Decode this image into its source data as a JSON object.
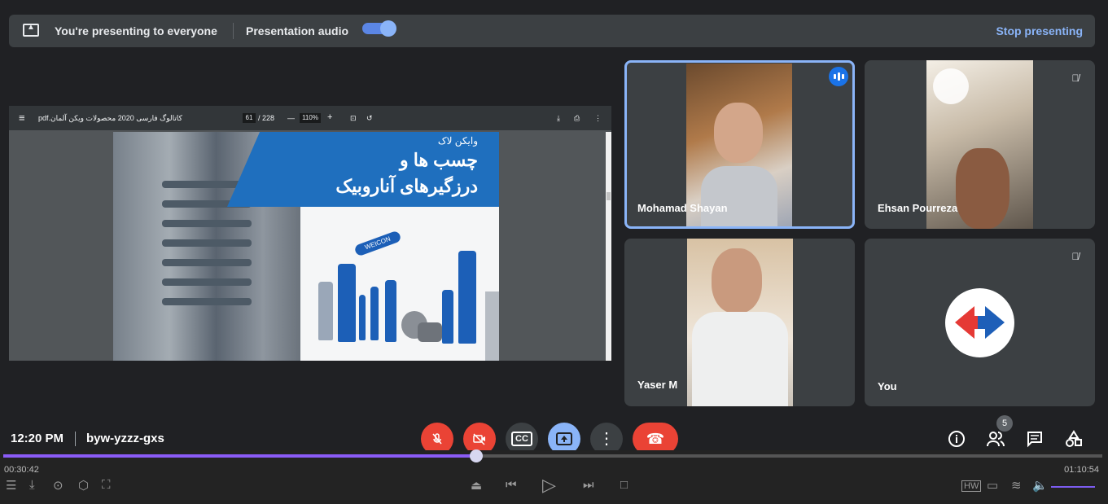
{
  "topbar": {
    "presenting_text": "You're presenting to everyone",
    "audio_label": "Presentation audio",
    "audio_on": true,
    "stop_label": "Stop presenting"
  },
  "pdf": {
    "filename": "کاتالوگ فارسی 2020 محصولات ویکن آلمان.pdf",
    "page_current": "61",
    "page_total": "/ 228",
    "zoom": "110%",
    "banner_line1": "وایکن لاک",
    "banner_line2": "چسب ها و",
    "banner_line3": "درزگیرهای آناروبیک",
    "product_brand": "WEICON"
  },
  "participants": [
    {
      "name": "Mohamad Shayan",
      "speaking": true
    },
    {
      "name": "Ehsan Pourreza",
      "muted": true
    },
    {
      "name": "Yaser M",
      "muted": false
    },
    {
      "name": "You",
      "muted": true
    }
  ],
  "meeting": {
    "time": "12:20 PM",
    "code": "byw-yzzz-gxs",
    "participant_count": "5"
  },
  "player": {
    "elapsed": "00:30:42",
    "total": "01:10:54",
    "progress_fraction": 0.43
  },
  "colors": {
    "accent": "#8ab4f8",
    "danger": "#ea4335",
    "progress": "#8b5cf6"
  }
}
